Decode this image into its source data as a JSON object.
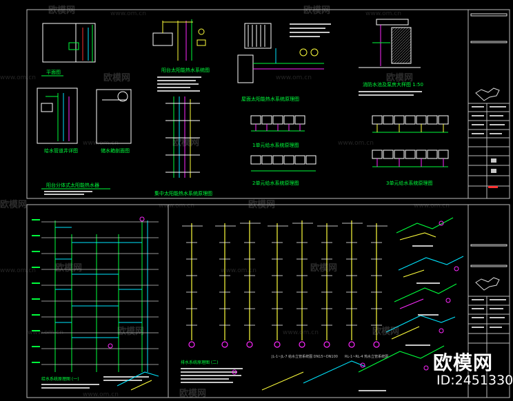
{
  "titles": {
    "plan_view": "平面图",
    "solar_balcony": "阳台太阳能热水系统图",
    "solar_roof_unit": "阳台分体式太阳能热水器",
    "pipe_detail": "给水管道井详图",
    "tank_detail": "储水箱剖面图",
    "central_system": "集中太阳能热水系统原理图",
    "roof_collector": "屋面太阳能热水系统原理图",
    "pump_well": "消防水池及泵房大样图 1:50",
    "unit_a": "1单元给水系统原理图",
    "unit_b": "2单元给水系统原理图",
    "unit_c": "3单元给水系统原理图",
    "riser_notes": "给水系统原理图 (一)",
    "drain_notes": "排水系统原理图 (二)",
    "axon_note_1": "JL-1~JL-7 给水立管系统图 DN15~DN100",
    "axon_note_2": "RL-1~RL-4 热水立管系统图"
  },
  "watermarks": {
    "brand": "欧模网",
    "url": "www.om.cn"
  },
  "corner_badge": {
    "brand": "欧模网",
    "id": "ID:2451330"
  },
  "colors": {
    "background": "#000000",
    "frame": "#c8c8c8",
    "green": "#00ff3c",
    "cyan": "#00e6ff",
    "magenta": "#ff28ff",
    "yellow": "#ffff3c",
    "white": "#ffffff",
    "red": "#ff3232"
  }
}
